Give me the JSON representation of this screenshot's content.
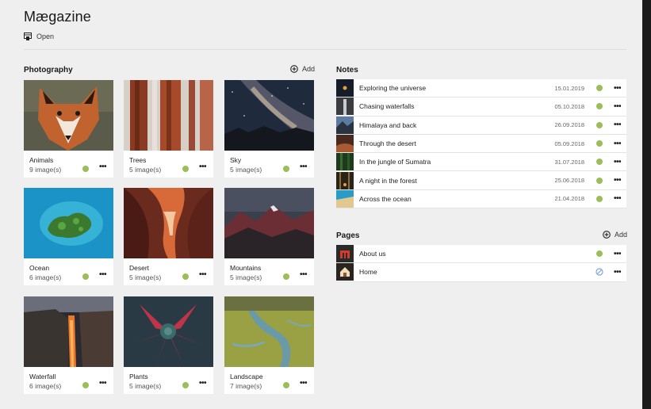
{
  "app": {
    "title": "Mægazine",
    "open_label": "Open"
  },
  "photography": {
    "heading": "Photography",
    "add_label": "Add",
    "cards": [
      {
        "name": "Animals",
        "count": "9 image(s)"
      },
      {
        "name": "Trees",
        "count": "5 image(s)"
      },
      {
        "name": "Sky",
        "count": "5 image(s)"
      },
      {
        "name": "Ocean",
        "count": "6 image(s)"
      },
      {
        "name": "Desert",
        "count": "5 image(s)"
      },
      {
        "name": "Mountains",
        "count": "5 image(s)"
      },
      {
        "name": "Waterfall",
        "count": "6 image(s)"
      },
      {
        "name": "Plants",
        "count": "5 image(s)"
      },
      {
        "name": "Landscape",
        "count": "7 image(s)"
      }
    ],
    "more_label": "•••"
  },
  "notes": {
    "heading": "Notes",
    "rows": [
      {
        "title": "Exploring the universe",
        "date": "15.01.2019"
      },
      {
        "title": "Chasing waterfalls",
        "date": "05.10.2018"
      },
      {
        "title": "Himalaya and back",
        "date": "26.09.2018"
      },
      {
        "title": "Through the desert",
        "date": "05.09.2018"
      },
      {
        "title": "In the jungle of Sumatra",
        "date": "31.07.2018"
      },
      {
        "title": "A night in the forest",
        "date": "25.06.2018"
      },
      {
        "title": "Across the ocean",
        "date": "21.04.2018"
      }
    ]
  },
  "pages": {
    "heading": "Pages",
    "add_label": "Add",
    "rows": [
      {
        "title": "About us",
        "status": "published"
      },
      {
        "title": "Home",
        "status": "disabled"
      }
    ]
  },
  "colors": {
    "status_green": "#9bbd5a",
    "disabled_blue": "#7fa8d8"
  }
}
